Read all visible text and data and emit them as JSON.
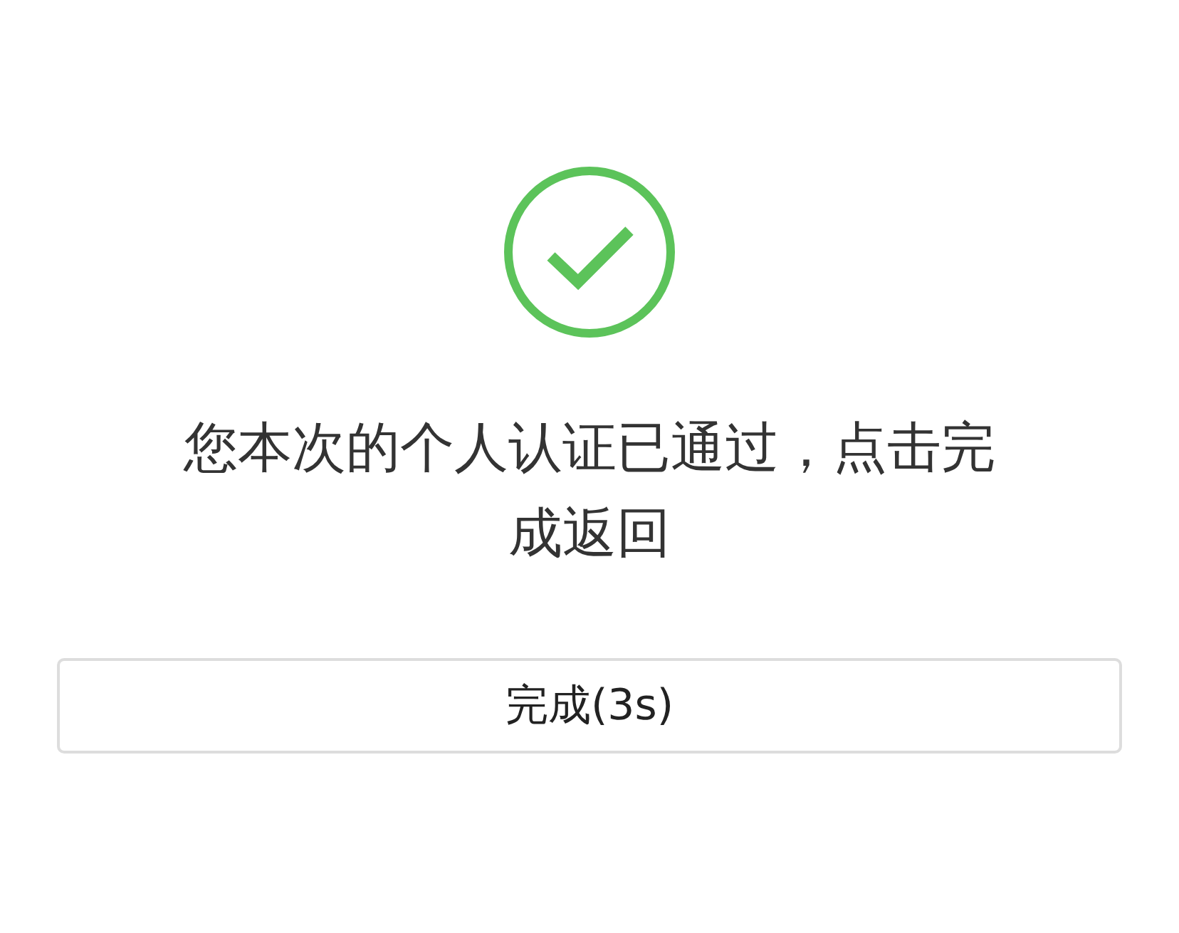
{
  "message": "您本次的个人认证已通过，点击完成返回",
  "button": {
    "label": "完成(3s)"
  }
}
